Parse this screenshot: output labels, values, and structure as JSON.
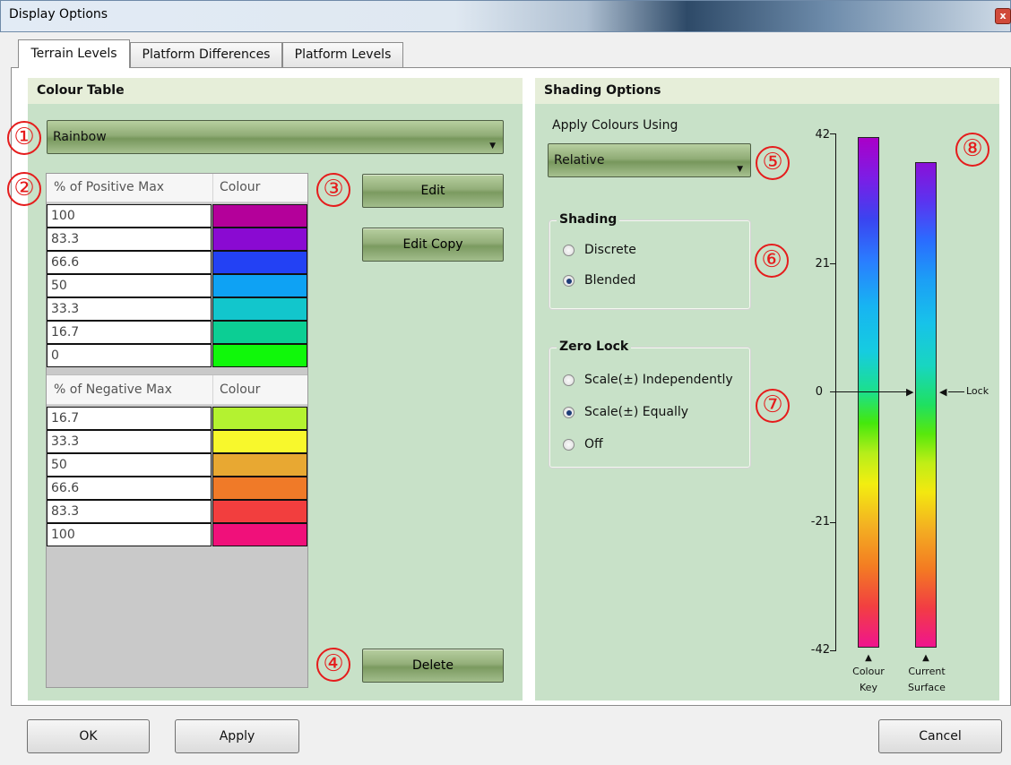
{
  "window": {
    "title": "Display Options",
    "close_glyph": "x"
  },
  "tabs": [
    {
      "label": "Terrain Levels",
      "active": true
    },
    {
      "label": "Platform Differences",
      "active": false
    },
    {
      "label": "Platform Levels",
      "active": false
    }
  ],
  "colour_table": {
    "heading": "Colour Table",
    "scheme": "Rainbow",
    "positive": {
      "header_value": "% of Positive Max",
      "header_colour": "Colour",
      "rows": [
        {
          "value": "100",
          "colour": "#b4009a"
        },
        {
          "value": "83.3",
          "colour": "#8a0ad2"
        },
        {
          "value": "66.6",
          "colour": "#2341f4"
        },
        {
          "value": "50",
          "colour": "#0ea2f4"
        },
        {
          "value": "33.3",
          "colour": "#12c6cc"
        },
        {
          "value": "16.7",
          "colour": "#0cce94"
        },
        {
          "value": "0",
          "colour": "#10f80a"
        }
      ]
    },
    "negative": {
      "header_value": "% of Negative Max",
      "header_colour": "Colour",
      "rows": [
        {
          "value": "16.7",
          "colour": "#b4f230"
        },
        {
          "value": "33.3",
          "colour": "#f8f82c"
        },
        {
          "value": "50",
          "colour": "#e8a832"
        },
        {
          "value": "66.6",
          "colour": "#f07a28"
        },
        {
          "value": "83.3",
          "colour": "#f23e3e"
        },
        {
          "value": "100",
          "colour": "#f0107a"
        }
      ]
    },
    "buttons": {
      "edit": "Edit",
      "edit_copy": "Edit Copy",
      "delete": "Delete"
    }
  },
  "shading_options": {
    "heading": "Shading Options",
    "apply_label": "Apply Colours Using",
    "apply_value": "Relative",
    "shading": {
      "title": "Shading",
      "options": [
        {
          "label": "Discrete",
          "selected": false
        },
        {
          "label": "Blended",
          "selected": true
        }
      ]
    },
    "zero_lock": {
      "title": "Zero Lock",
      "options": [
        {
          "label": "Scale(±) Independently",
          "selected": false
        },
        {
          "label": "Scale(±) Equally",
          "selected": true
        },
        {
          "label": "Off",
          "selected": false
        }
      ]
    },
    "scale": {
      "ticks": [
        "42",
        "21",
        "0",
        "-21",
        "-42"
      ],
      "lock_label": "Lock",
      "colour_key_line1": "Colour",
      "colour_key_line2": "Key",
      "current_surface_line1": "Current",
      "current_surface_line2": "Surface",
      "marker_glyph": "▲"
    }
  },
  "markers": [
    "①",
    "②",
    "③",
    "④",
    "⑤",
    "⑥",
    "⑦",
    "⑧"
  ],
  "footer": {
    "ok": "OK",
    "apply": "Apply",
    "cancel": "Cancel"
  },
  "colors": {
    "panel_green": "#c8e1c8",
    "header_green": "#e6eed9",
    "annotation_red": "#e51c1c"
  }
}
